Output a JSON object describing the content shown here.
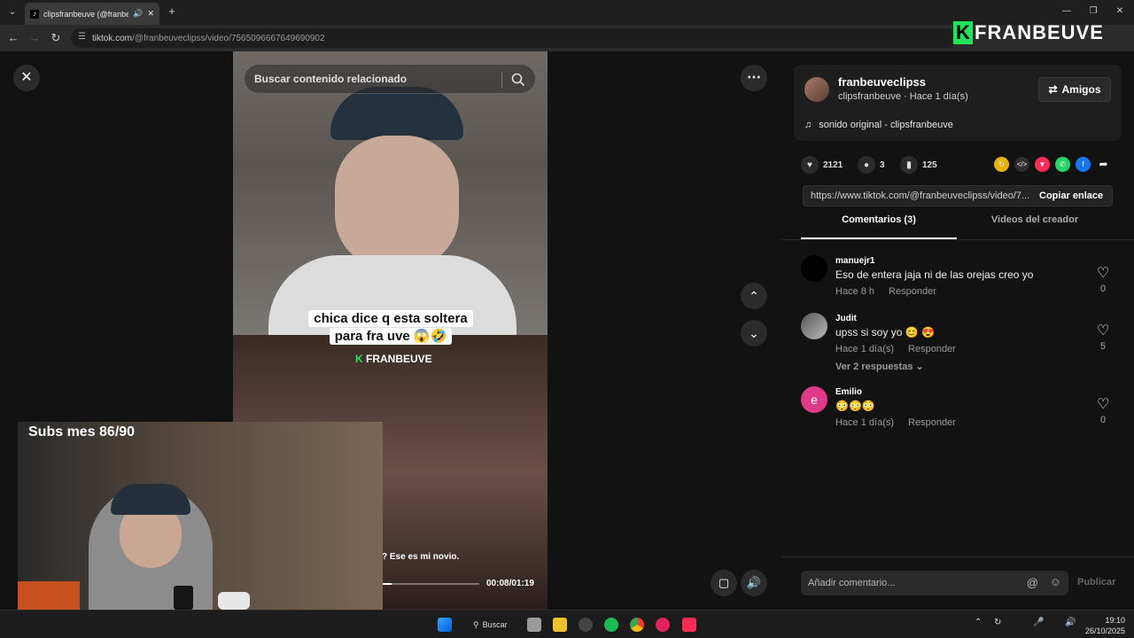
{
  "browser": {
    "tab_title": "clipsfranbeuve (@franbeuve",
    "url_host": "tiktok.com",
    "url_path": "/@franbeuveclipss/video/7565096667649690902"
  },
  "overlay": {
    "logo_letter": "K",
    "logo_text": "FRANBEUVE",
    "webcam_label": "Subs mes 86/90"
  },
  "video": {
    "search_placeholder": "Buscar contenido relacionado",
    "caption_line1": "chica dice q   esta soltera",
    "caption_line2": "para fra    uve 😱🤣",
    "brand_letter": "K",
    "brand_text": "FRANBEUVE",
    "subtitle": "? Ese es mi novio.",
    "time": "00:08/01:19",
    "progress": 0.1
  },
  "author": {
    "username": "franbeuveclipss",
    "meta": "clipsfranbeuve · Hace 1 día(s)",
    "friends_label": "Amigos",
    "music": "sonido original - clipsfranbeuve"
  },
  "stats": {
    "likes": "2121",
    "comments": "3",
    "saves": "125"
  },
  "link": {
    "url": "https://www.tiktok.com/@franbeuveclipss/video/7...",
    "copy_label": "Copiar enlace"
  },
  "tabs": {
    "comments": "Comentarios (3)",
    "creator_videos": "Videos del creador"
  },
  "comments": [
    {
      "user": "manuejr1",
      "text": "Eso de entera jaja ni de las orejas creo yo",
      "time": "Hace 8 h",
      "reply": "Responder",
      "likes": "0"
    },
    {
      "user": "Judit",
      "text": "upss si soy yo 😊 😍",
      "time": "Hace 1 día(s)",
      "reply": "Responder",
      "likes": "5",
      "view_replies": "Ver 2 respuestas"
    },
    {
      "user": "Emilio",
      "avatar_letter": "e",
      "text": "😳😳😳",
      "time": "Hace 1 día(s)",
      "reply": "Responder",
      "likes": "0"
    }
  ],
  "composer": {
    "placeholder": "Añadir comentario...",
    "publish": "Publicar"
  },
  "taskbar": {
    "search": "Buscar",
    "time": "19:10",
    "date": "26/10/2025"
  },
  "colors": {
    "accent_green": "#23e35a",
    "tiktok_red": "#fe2c55",
    "emilio_avatar": "#e0398a"
  }
}
